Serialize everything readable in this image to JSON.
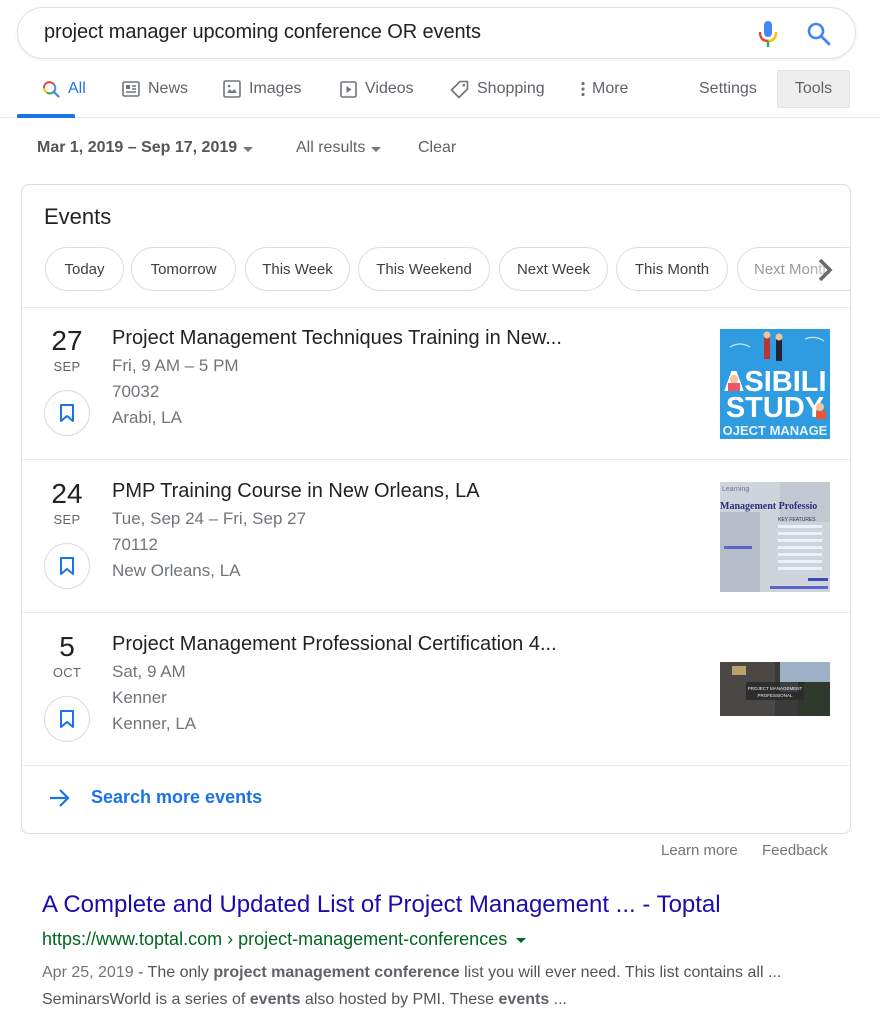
{
  "search": {
    "query": "project manager upcoming conference OR events",
    "mic_icon": "microphone-icon",
    "search_icon": "search-icon"
  },
  "tabs": {
    "items": [
      {
        "label": "All",
        "icon": "search-icon",
        "active": true
      },
      {
        "label": "News",
        "icon": "news-icon"
      },
      {
        "label": "Images",
        "icon": "image-icon"
      },
      {
        "label": "Videos",
        "icon": "play-icon"
      },
      {
        "label": "Shopping",
        "icon": "tag-icon"
      },
      {
        "label": "More",
        "icon": "more-vert-icon"
      }
    ],
    "settings": "Settings",
    "tools": "Tools"
  },
  "filters": {
    "date_range": "Mar 1, 2019 – Sep 17, 2019",
    "results": "All results",
    "clear": "Clear"
  },
  "events": {
    "title": "Events",
    "chips": [
      "Today",
      "Tomorrow",
      "This Week",
      "This Weekend",
      "Next Week",
      "This Month",
      "Next Month"
    ],
    "items": [
      {
        "day": "27",
        "month": "SEP",
        "title": "Project Management Techniques Training in New...",
        "when": "Fri, 9 AM – 5 PM",
        "venue": "70032",
        "location": "Arabi, LA",
        "thumb_text": [
          "ASIBILI",
          "STUDY",
          "OJECT MANAGE"
        ]
      },
      {
        "day": "24",
        "month": "SEP",
        "title": "PMP Training Course in New Orleans, LA",
        "when": "Tue, Sep 24 – Fri, Sep 27",
        "venue": "70112",
        "location": "New Orleans, LA",
        "thumb_text": [
          "Learning",
          "Management Professio",
          "KEY FEATURES"
        ]
      },
      {
        "day": "5",
        "month": "OCT",
        "title": "Project Management Professional Certification 4...",
        "when": "Sat, 9 AM",
        "venue": "Kenner",
        "location": "Kenner, LA",
        "thumb_text": [
          "PROJECT MANAGEMENT",
          "PROFESSIONAL"
        ]
      }
    ],
    "search_more": "Search more events"
  },
  "footer": {
    "learn_more": "Learn more",
    "feedback": "Feedback"
  },
  "result": {
    "title": "A Complete and Updated List of Project Management ... - Toptal",
    "url": "https://www.toptal.com › project-management-conferences",
    "date": "Apr 25, 2019",
    "snippet_parts": [
      {
        "t": " - The only ",
        "b": false
      },
      {
        "t": "project management conference",
        "b": true
      },
      {
        "t": " list you will ever need. This list contains all ... SeminarsWorld is a series of ",
        "b": false
      },
      {
        "t": "events",
        "b": true
      },
      {
        "t": " also hosted by PMI. These ",
        "b": false
      },
      {
        "t": "events",
        "b": true
      },
      {
        "t": " ...",
        "b": false
      }
    ]
  },
  "colors": {
    "accent_blue": "#1a73e8",
    "link_title": "#1a0dab",
    "url_green": "#006621",
    "text_gray": "#70757a"
  }
}
